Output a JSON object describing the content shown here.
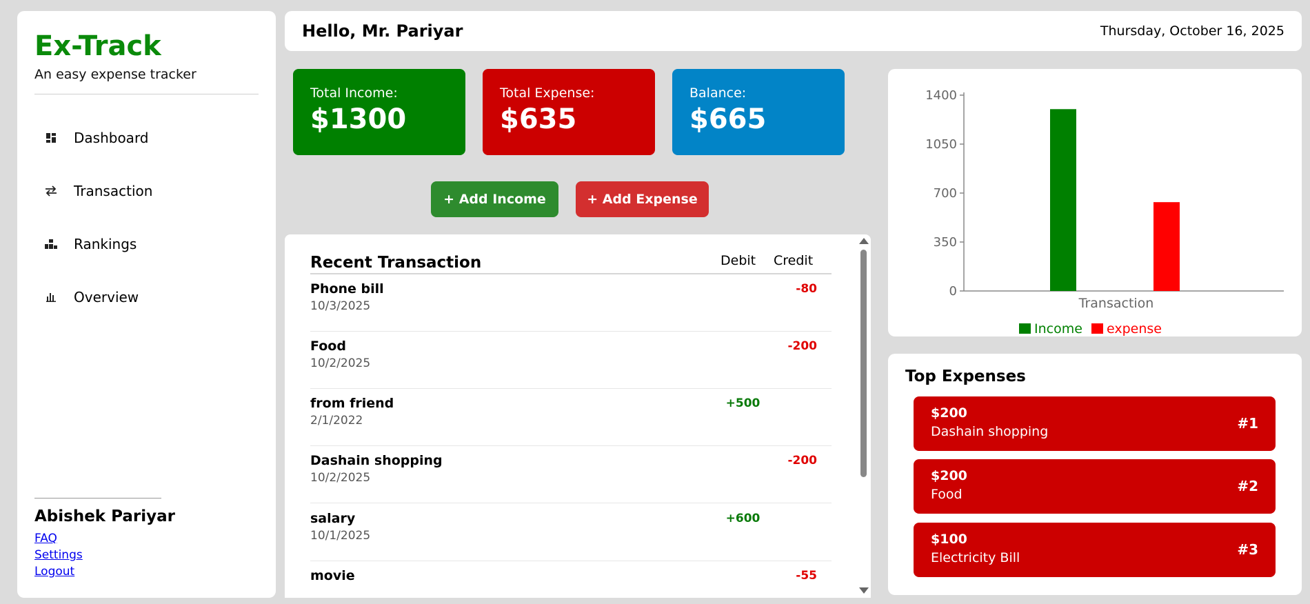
{
  "sidebar": {
    "brand": "Ex-Track",
    "tagline": "An easy expense tracker",
    "nav": [
      {
        "label": "Dashboard",
        "icon": "dashboard-icon"
      },
      {
        "label": "Transaction",
        "icon": "transfer-icon"
      },
      {
        "label": "Rankings",
        "icon": "podium-icon"
      },
      {
        "label": "Overview",
        "icon": "bar-chart-icon"
      }
    ],
    "user_name": "Abishek Pariyar",
    "links": [
      "FAQ",
      "Settings",
      "Logout"
    ]
  },
  "header": {
    "greeting": "Hello, Mr. Pariyar",
    "date": "Thursday, October 16, 2025"
  },
  "summary": {
    "income_label": "Total Income:",
    "income_value": "$1300",
    "expense_label": "Total Expense:",
    "expense_value": "$635",
    "balance_label": "Balance:",
    "balance_value": "$665"
  },
  "actions": {
    "add_income": "+ Add Income",
    "add_expense": "+ Add Expense"
  },
  "transactions": {
    "title": "Recent Transaction",
    "debit_header": "Debit",
    "credit_header": "Credit",
    "rows": [
      {
        "name": "Phone bill",
        "date": "10/3/2025",
        "debit": "",
        "credit": "-80"
      },
      {
        "name": "Food",
        "date": "10/2/2025",
        "debit": "",
        "credit": "-200"
      },
      {
        "name": "from friend",
        "date": "2/1/2022",
        "debit": "+500",
        "credit": ""
      },
      {
        "name": "Dashain shopping",
        "date": "10/2/2025",
        "debit": "",
        "credit": "-200"
      },
      {
        "name": "salary",
        "date": "10/1/2025",
        "debit": "+600",
        "credit": ""
      },
      {
        "name": "movie",
        "date": "",
        "debit": "",
        "credit": "-55"
      }
    ]
  },
  "chart_data": {
    "type": "bar",
    "categories": [
      "Transaction"
    ],
    "series": [
      {
        "name": "Income",
        "values": [
          1300
        ],
        "color": "#008000"
      },
      {
        "name": "expense",
        "values": [
          635
        ],
        "color": "#ff0000"
      }
    ],
    "ylim": [
      0,
      1400
    ],
    "yticks": [
      "0",
      "350",
      "700",
      "1050",
      "1400"
    ],
    "legend": "bottom"
  },
  "top_expenses": {
    "title": "Top Expenses",
    "items": [
      {
        "amount": "$200",
        "label": "Dashain shopping",
        "rank": "#1"
      },
      {
        "amount": "$200",
        "label": "Food",
        "rank": "#2"
      },
      {
        "amount": "$100",
        "label": "Electricity Bill",
        "rank": "#3"
      }
    ]
  },
  "colors": {
    "brand": "#0a8a0a",
    "income_card": "#008000",
    "expense_card": "#cc0000",
    "balance_card": "#0284c7",
    "add_income_btn": "#2e8b2e",
    "add_expense_btn": "#d32f2f"
  }
}
